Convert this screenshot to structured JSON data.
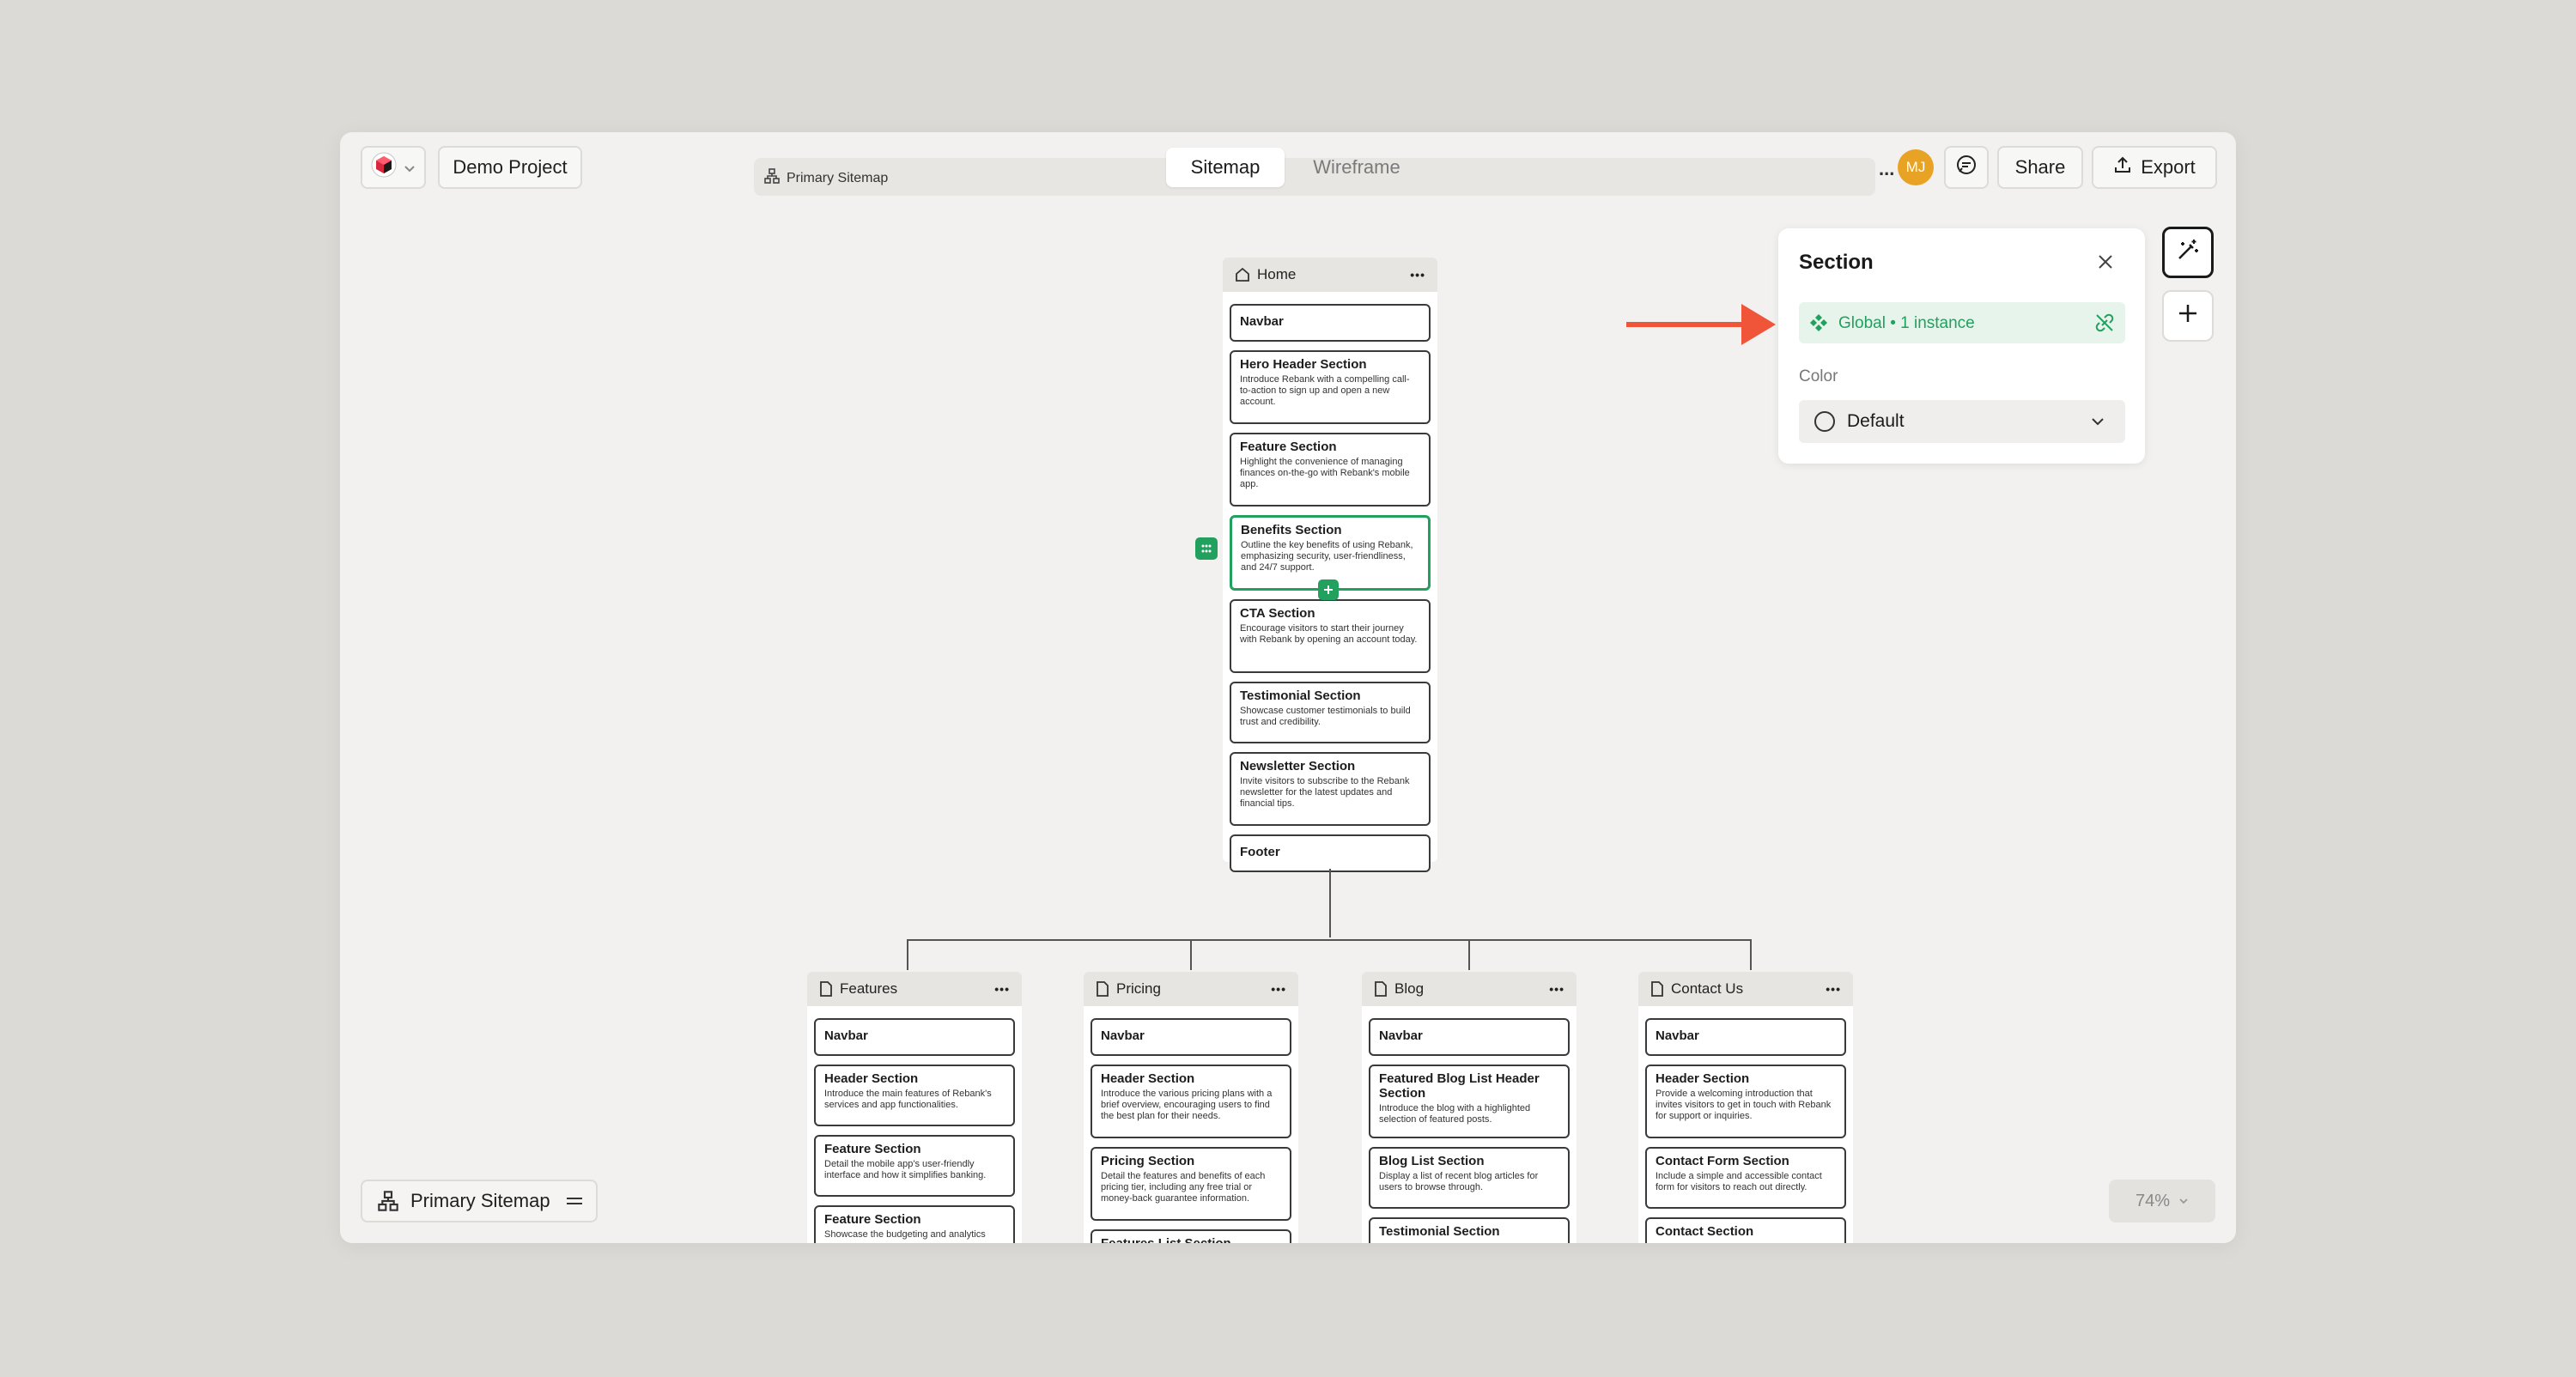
{
  "toolbar": {
    "project_name": "Demo Project",
    "breadcrumb": "Primary Sitemap",
    "tabs": [
      {
        "label": "Sitemap",
        "active": true
      },
      {
        "label": "Wireframe",
        "active": false
      }
    ],
    "more_label": "...",
    "avatar_initials": "MJ",
    "share_label": "Share",
    "export_label": "Export"
  },
  "section_panel": {
    "title": "Section",
    "global_label": "Global • 1 instance",
    "color_label": "Color",
    "color_value": "Default"
  },
  "home": {
    "title": "Home",
    "sections": [
      {
        "title": "Navbar",
        "desc": ""
      },
      {
        "title": "Hero Header Section",
        "desc": "Introduce Rebank with a compelling call-to-action to sign up and open a new account."
      },
      {
        "title": "Feature Section",
        "desc": "Highlight the convenience of managing finances on-the-go with Rebank's mobile app."
      },
      {
        "title": "Benefits Section",
        "desc": "Outline the key benefits of using Rebank, emphasizing security, user-friendliness, and 24/7 support."
      },
      {
        "title": "CTA Section",
        "desc": "Encourage visitors to start their journey with Rebank by opening an account today."
      },
      {
        "title": "Testimonial Section",
        "desc": "Showcase customer testimonials to build trust and credibility."
      },
      {
        "title": "Newsletter Section",
        "desc": "Invite visitors to subscribe to the Rebank newsletter for the latest updates and financial tips."
      },
      {
        "title": "Footer",
        "desc": ""
      }
    ]
  },
  "pages": [
    {
      "title": "Features",
      "sections": [
        {
          "title": "Navbar",
          "desc": ""
        },
        {
          "title": "Header Section",
          "desc": "Introduce the main features of Rebank's services and app functionalities."
        },
        {
          "title": "Feature Section",
          "desc": "Detail the mobile app's user-friendly interface and how it simplifies banking."
        },
        {
          "title": "Feature Section",
          "desc": "Showcase the budgeting and analytics"
        }
      ]
    },
    {
      "title": "Pricing",
      "sections": [
        {
          "title": "Navbar",
          "desc": ""
        },
        {
          "title": "Header Section",
          "desc": "Introduce the various pricing plans with a brief overview, encouraging users to find the best plan for their needs."
        },
        {
          "title": "Pricing Section",
          "desc": "Detail the features and benefits of each pricing tier, including any free trial or money-back guarantee information."
        },
        {
          "title": "Features List Section",
          "desc": ""
        }
      ]
    },
    {
      "title": "Blog",
      "sections": [
        {
          "title": "Navbar",
          "desc": ""
        },
        {
          "title": "Featured Blog List Header Section",
          "desc": "Introduce the blog with a highlighted selection of featured posts."
        },
        {
          "title": "Blog List Section",
          "desc": "Display a list of recent blog articles for users to browse through."
        },
        {
          "title": "Testimonial Section",
          "desc": ""
        }
      ]
    },
    {
      "title": "Contact Us",
      "sections": [
        {
          "title": "Navbar",
          "desc": ""
        },
        {
          "title": "Header Section",
          "desc": "Provide a welcoming introduction that invites visitors to get in touch with Rebank for support or inquiries."
        },
        {
          "title": "Contact Form Section",
          "desc": "Include a simple and accessible contact form for visitors to reach out directly."
        },
        {
          "title": "Contact Section",
          "desc": ""
        }
      ]
    }
  ],
  "bottom": {
    "sitemap_label": "Primary Sitemap",
    "zoom": "74%"
  },
  "colors": {
    "accent_green": "#21a05e",
    "arrow_red": "#f0553a",
    "avatar": "#e8a325"
  }
}
